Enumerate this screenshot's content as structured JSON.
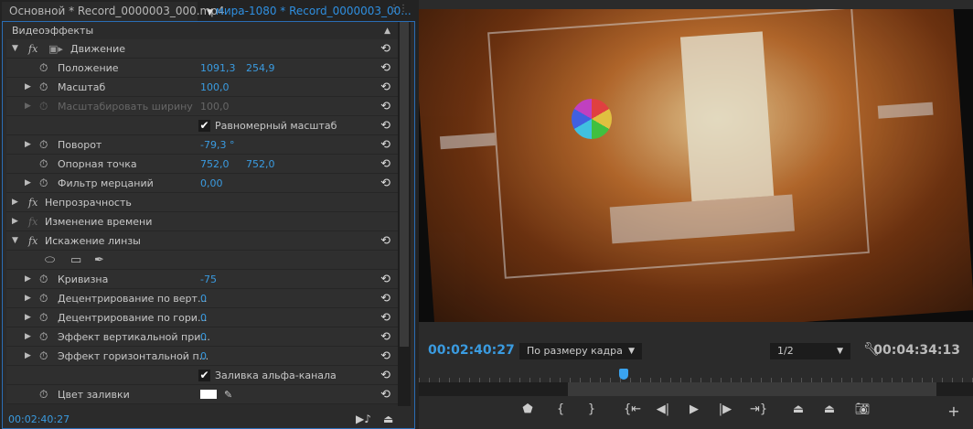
{
  "tabs": {
    "source": "Основной * Record_0000003_000.mp4",
    "active": "мира-1080 * Record_0000003_00..."
  },
  "panel": {
    "header": "Видеоэффекты",
    "timecode": "00:02:40:27"
  },
  "effects": {
    "motion": "Движение",
    "position": {
      "label": "Положение",
      "x": "1091,3",
      "y": "254,9"
    },
    "scale": {
      "label": "Масштаб",
      "value": "100,0"
    },
    "scale_width": {
      "label": "Масштабировать ширину",
      "value": "100,0"
    },
    "uniform": {
      "label": "Равномерный масштаб",
      "checked": true
    },
    "rotation": {
      "label": "Поворот",
      "value": "-79,3 °"
    },
    "anchor": {
      "label": "Опорная точка",
      "x": "752,0",
      "y": "752,0"
    },
    "flicker": {
      "label": "Фильтр мерцаний",
      "value": "0,00"
    },
    "opacity": "Непрозрачность",
    "time_remap": "Изменение времени",
    "lens": "Искажение линзы",
    "curvature": {
      "label": "Кривизна",
      "value": "-75"
    },
    "vdec": {
      "label": "Децентрирование по верт...",
      "value": "0"
    },
    "hdec": {
      "label": "Децентрирование по гори...",
      "value": "0"
    },
    "vprism": {
      "label": "Эффект вертикальной при...",
      "value": "0"
    },
    "hprism": {
      "label": "Эффект горизонтальной п...",
      "value": "0"
    },
    "alpha_fill": {
      "label": "Заливка альфа-канала",
      "checked": true
    },
    "fill_color": {
      "label": "Цвет заливки",
      "color": "#ffffff"
    }
  },
  "monitor": {
    "current_time": "00:02:40:27",
    "zoom": "По размеру кадра",
    "resolution": "1/2",
    "duration": "00:04:34:13",
    "playhead_fraction": 0.37
  },
  "colors": {
    "accent": "#3a9be0",
    "panel_border": "#2a6db5"
  }
}
